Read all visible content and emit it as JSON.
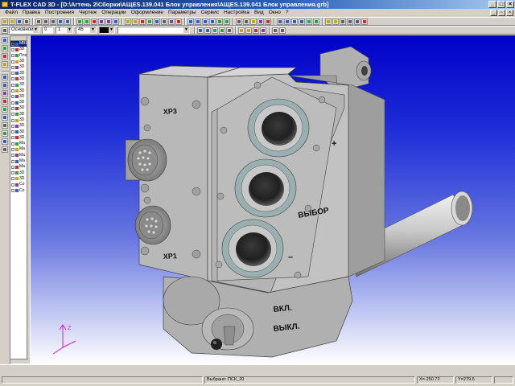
{
  "window": {
    "title": "T-FLEX CAD 3D - [D:\\Агтень 2\\Сборки\\АЩЕS.139.041 Блок управления\\АЩЕS.139.041 Блок управления.grb]"
  },
  "menu": {
    "items": [
      "Файл",
      "Правка",
      "Построения",
      "Чертеж",
      "Операции",
      "Оформление",
      "Параметры",
      "Сервис",
      "Настройка",
      "Вид",
      "Окно",
      "?"
    ]
  },
  "toolbar": {
    "layer_combo": "Основной",
    "line_width": "0",
    "color_field": "1",
    "style_field": "45"
  },
  "tree": {
    "items": [
      "МВЕ5",
      "3D",
      "Пло",
      "3D",
      "3D",
      "3D",
      "3D",
      "3D",
      "3D",
      "3D",
      "3D",
      "3D",
      "3D",
      "3D",
      "3D",
      "3D",
      "3D",
      "Ma",
      "Ma",
      "Ma",
      "Ma",
      "Ma",
      "3D",
      "3D",
      "Co",
      "Co"
    ]
  },
  "model": {
    "labels": {
      "xp3": "ХР3",
      "xp1": "ХР1",
      "plus": "+",
      "minus": "–",
      "select": "ВЫБОР",
      "on": "ВКЛ.",
      "off": "ВЫКЛ."
    },
    "axis_label": "Z"
  },
  "status": {
    "selection": "Выбрано: ПСК_20",
    "x_coord": "X=-250.72",
    "y_coord": "Y=279.6"
  }
}
